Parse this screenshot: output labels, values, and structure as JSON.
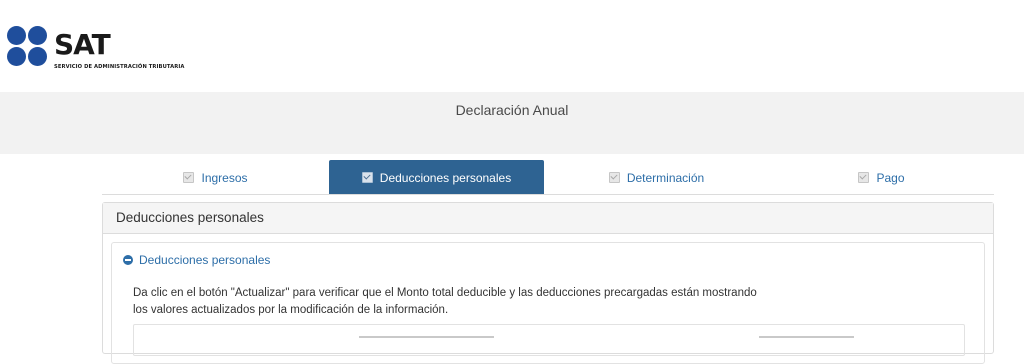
{
  "logo": {
    "word": "SAT",
    "subtitle": "SERVICIO DE ADMINISTRACIÓN TRIBUTARIA",
    "brand_color": "#1f4e9c"
  },
  "header": {
    "title": "Declaración Anual"
  },
  "tabs": [
    {
      "label": "Ingresos",
      "active": false,
      "icon": "checkbox-checked-icon"
    },
    {
      "label": "Deducciones personales",
      "active": true,
      "icon": "checkbox-checked-icon"
    },
    {
      "label": "Determinación",
      "active": false,
      "icon": "checkbox-checked-icon"
    },
    {
      "label": "Pago",
      "active": false,
      "icon": "checkbox-checked-icon"
    }
  ],
  "panel": {
    "title": "Deducciones personales",
    "section": {
      "title": "Deducciones personales",
      "icon": "minus-circle-icon",
      "description_line1": "Da clic en el botón \"Actualizar\" para verificar que el Monto total deducible y las deducciones precargadas están mostrando",
      "description_line2": "los valores actualizados por la modificación de la información."
    }
  },
  "colors": {
    "accent": "#2e6392",
    "link": "#2d6ea8"
  }
}
